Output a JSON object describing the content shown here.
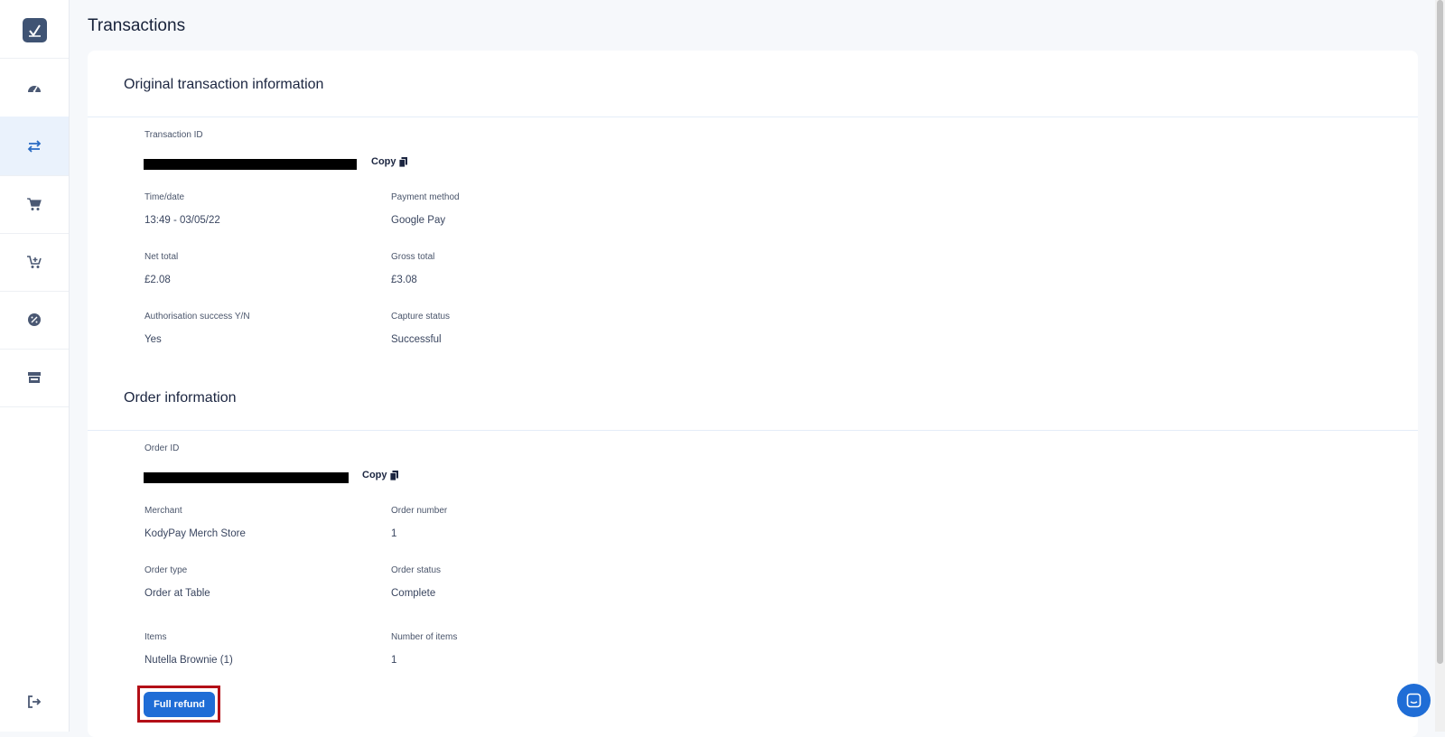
{
  "page": {
    "title": "Transactions"
  },
  "colors": {
    "accent": "#1f6dd6",
    "highlight": "#b30f17",
    "sidebar_active": "#eaf2fc"
  },
  "sidebar": {
    "items": [
      {
        "icon": "dashboard-icon"
      },
      {
        "icon": "transfer-arrows-icon"
      },
      {
        "icon": "cart-icon"
      },
      {
        "icon": "cart-plus-icon"
      },
      {
        "icon": "discount-badge-icon"
      },
      {
        "icon": "store-icon"
      }
    ],
    "logout_icon": "logout-icon"
  },
  "transaction": {
    "section_title": "Original transaction information",
    "transaction_id_label": "Transaction ID",
    "copy_label": "Copy",
    "time_label": "Time/date",
    "time_value": "13:49 - 03/05/22",
    "payment_method_label": "Payment method",
    "payment_method_value": "Google Pay",
    "net_total_label": "Net total",
    "net_total_value": "£2.08",
    "gross_total_label": "Gross total",
    "gross_total_value": "£3.08",
    "auth_label": "Authorisation success Y/N",
    "auth_value": "Yes",
    "capture_label": "Capture status",
    "capture_value": "Successful"
  },
  "order": {
    "section_title": "Order information",
    "order_id_label": "Order ID",
    "copy_label": "Copy",
    "merchant_label": "Merchant",
    "merchant_value": "KodyPay Merch Store",
    "order_number_label": "Order number",
    "order_number_value": "1",
    "order_type_label": "Order type",
    "order_type_value": "Order at Table",
    "order_status_label": "Order status",
    "order_status_value": "Complete",
    "items_label": "Items",
    "items_value": "Nutella Brownie (1)",
    "num_items_label": "Number of items",
    "num_items_value": "1"
  },
  "actions": {
    "full_refund_label": "Full refund"
  }
}
